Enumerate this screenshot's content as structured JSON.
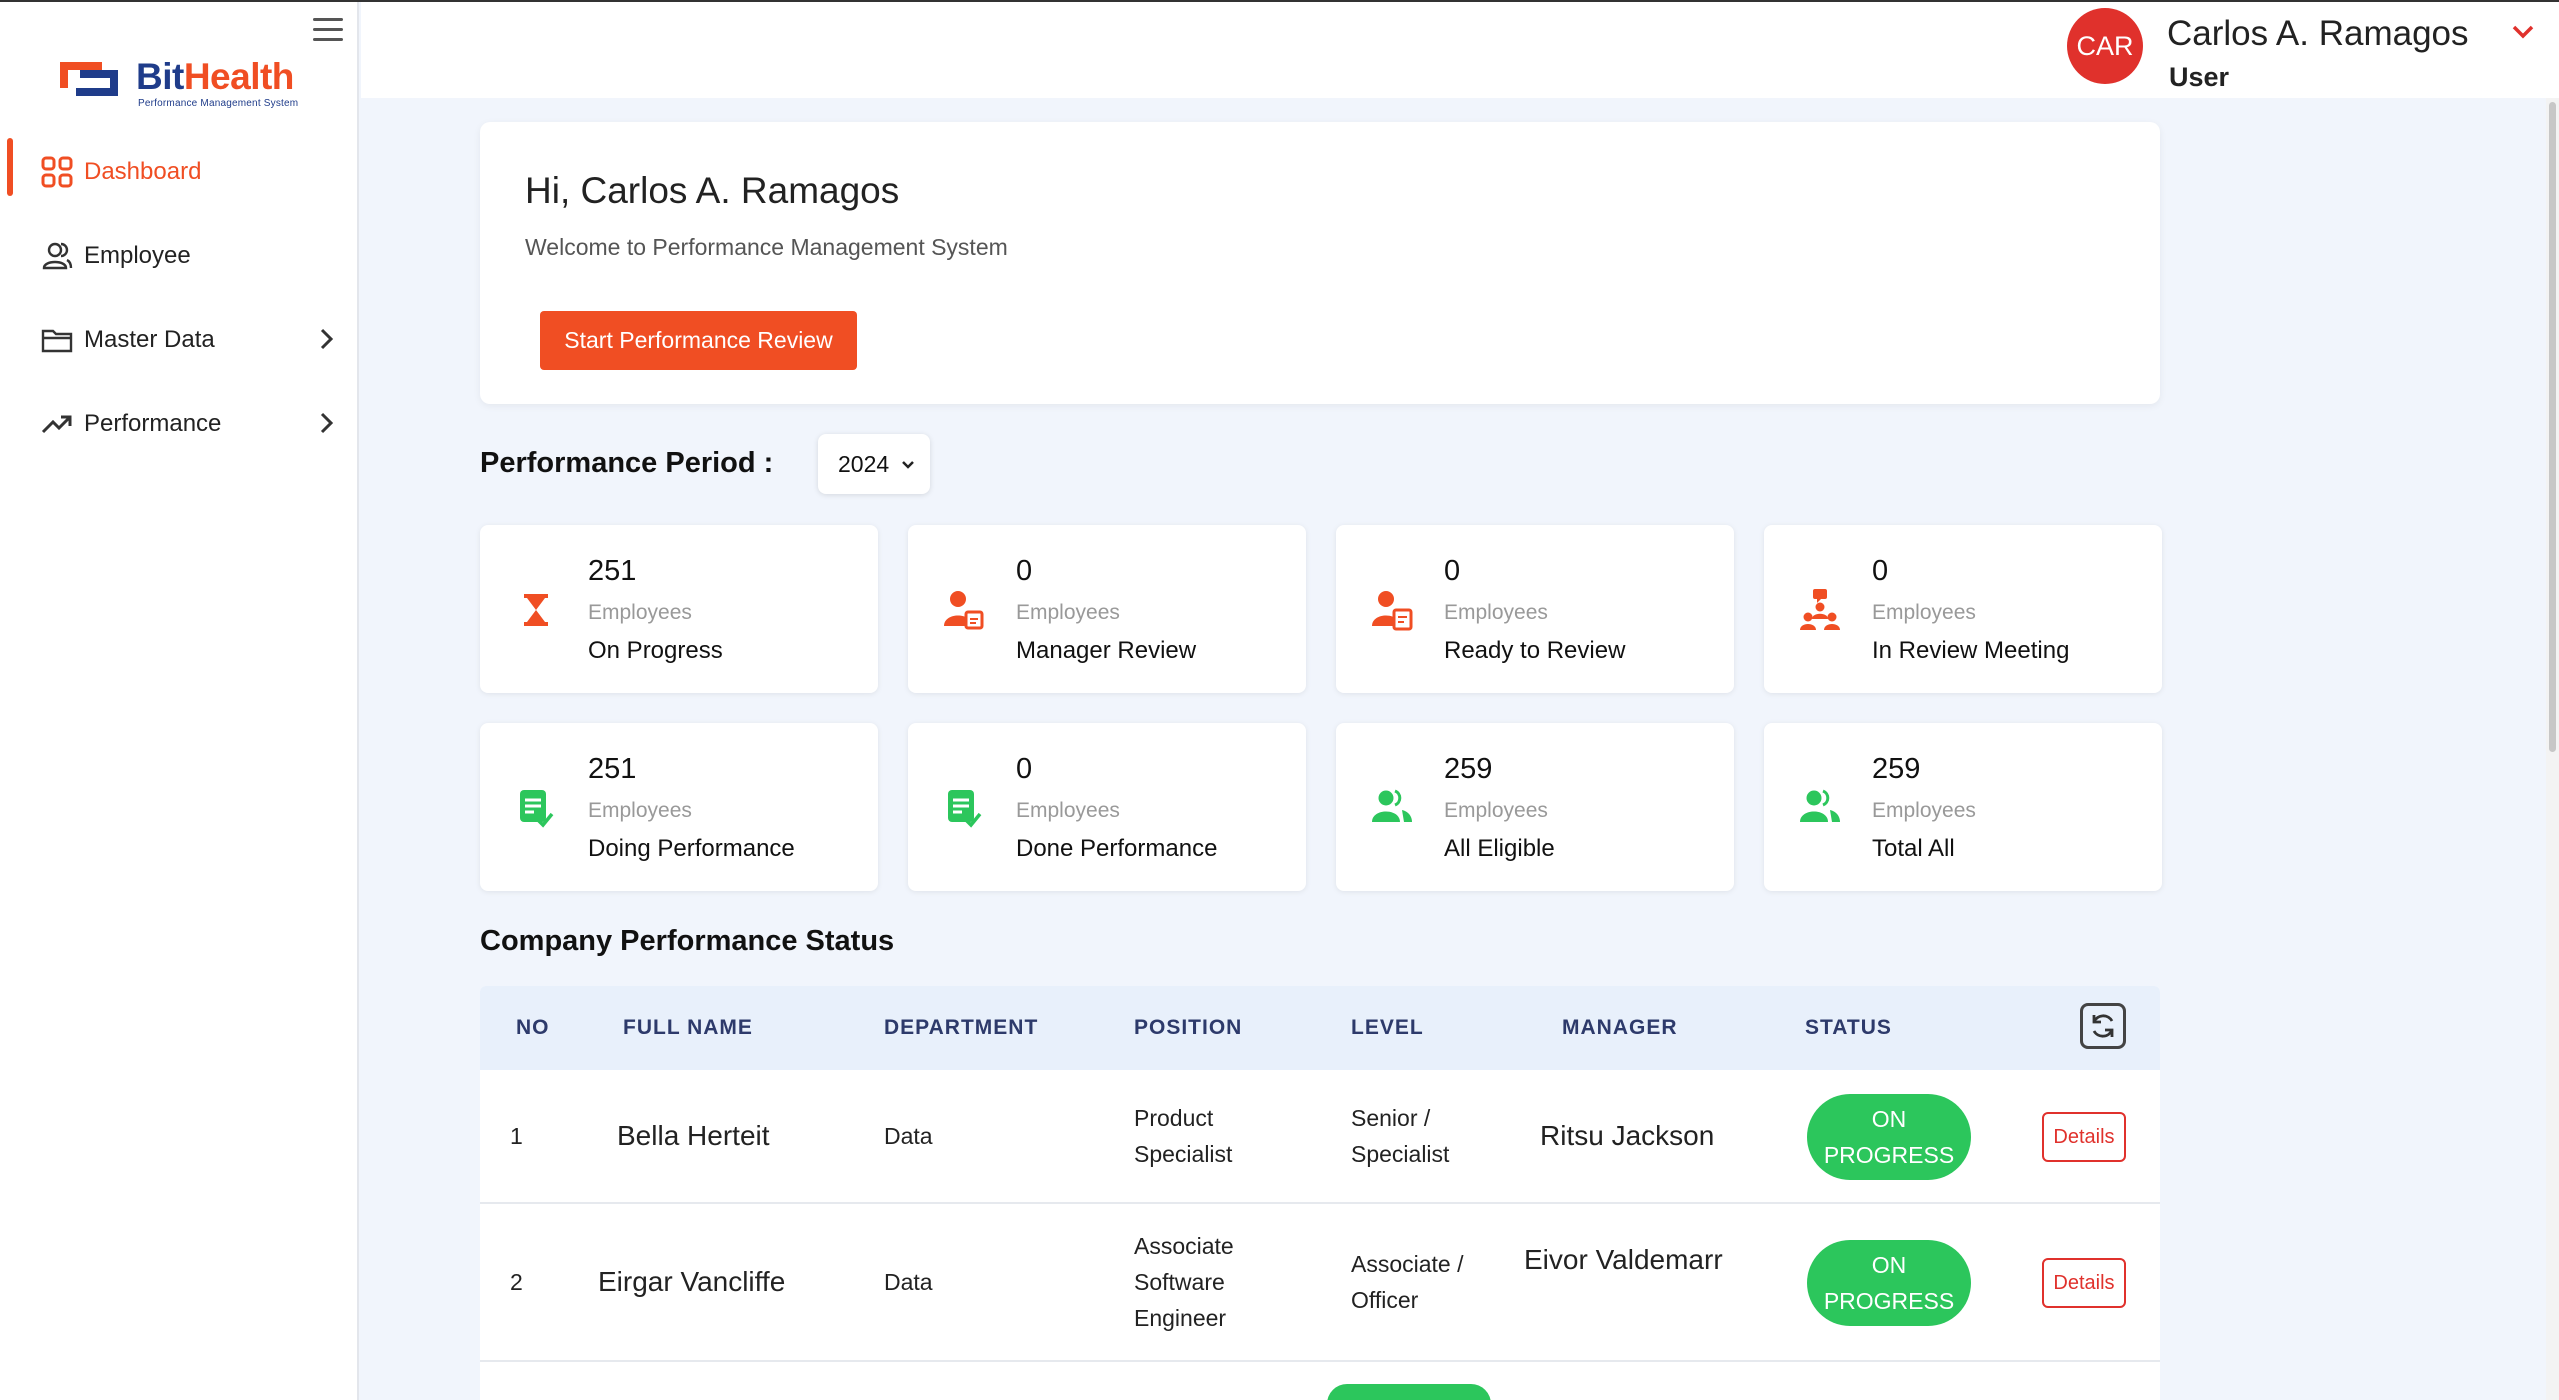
{
  "sidebar": {
    "logo": {
      "brand_part1": "Bit",
      "brand_part2": "Health",
      "tagline": "Performance Management System"
    },
    "items": [
      {
        "label": "Dashboard",
        "icon": "dashboard-grid-icon",
        "active": true
      },
      {
        "label": "Employee",
        "icon": "users-icon"
      },
      {
        "label": "Master Data",
        "icon": "folder-icon",
        "has_submenu": true
      },
      {
        "label": "Performance",
        "icon": "trending-up-icon",
        "has_submenu": true
      }
    ]
  },
  "header": {
    "avatar_initials": "CAR",
    "user_name": "Carlos A. Ramagos",
    "user_role": "User"
  },
  "welcome": {
    "greeting": "Hi, Carlos A. Ramagos",
    "subtitle": "Welcome to Performance Management System",
    "start_button": "Start Performance Review"
  },
  "period": {
    "label": "Performance Period :",
    "selected": "2024"
  },
  "stats": [
    {
      "count": "251",
      "unit": "Employees",
      "label": "On Progress",
      "icon": "hourglass-icon",
      "color": "#f04e23"
    },
    {
      "count": "0",
      "unit": "Employees",
      "label": "Manager Review",
      "icon": "user-document-icon",
      "color": "#f04e23"
    },
    {
      "count": "0",
      "unit": "Employees",
      "label": "Ready to Review",
      "icon": "user-checklist-icon",
      "color": "#f04e23"
    },
    {
      "count": "0",
      "unit": "Employees",
      "label": "In Review Meeting",
      "icon": "meeting-icon",
      "color": "#f04e23"
    },
    {
      "count": "251",
      "unit": "Employees",
      "label": "Doing Performance",
      "icon": "doc-check-icon",
      "color": "#2cc65c"
    },
    {
      "count": "0",
      "unit": "Employees",
      "label": "Done Performance",
      "icon": "doc-check-icon",
      "color": "#2cc65c"
    },
    {
      "count": "259",
      "unit": "Employees",
      "label": "All Eligible",
      "icon": "users-group-icon",
      "color": "#2cc65c"
    },
    {
      "count": "259",
      "unit": "Employees",
      "label": "Total All",
      "icon": "users-group-icon",
      "color": "#2cc65c"
    }
  ],
  "table": {
    "title": "Company Performance Status",
    "columns": [
      "NO",
      "FULL NAME",
      "DEPARTMENT",
      "POSITION",
      "LEVEL",
      "MANAGER",
      "STATUS"
    ],
    "rows": [
      {
        "no": "1",
        "full_name": "Bella Herteit",
        "department": "Data",
        "position_lines": [
          "Product",
          "Specialist"
        ],
        "level_lines": [
          "Senior /",
          "Specialist"
        ],
        "manager": "Ritsu Jackson",
        "status_lines": [
          "ON",
          "PROGRESS"
        ],
        "action": "Details"
      },
      {
        "no": "2",
        "full_name": "Eirgar Vancliffe",
        "department": "Data",
        "position_lines": [
          "Associate",
          "Software",
          "Engineer"
        ],
        "level_lines": [
          "Associate /",
          "Officer"
        ],
        "manager": "Eivor Valdemarr",
        "status_lines": [
          "ON",
          "PROGRESS"
        ],
        "action": "Details"
      }
    ]
  },
  "colors": {
    "accent": "#f04e23",
    "brand_blue": "#1f3c8a",
    "success": "#2cc65c",
    "avatar": "#e0312c",
    "page_bg": "#f1f5fc"
  }
}
